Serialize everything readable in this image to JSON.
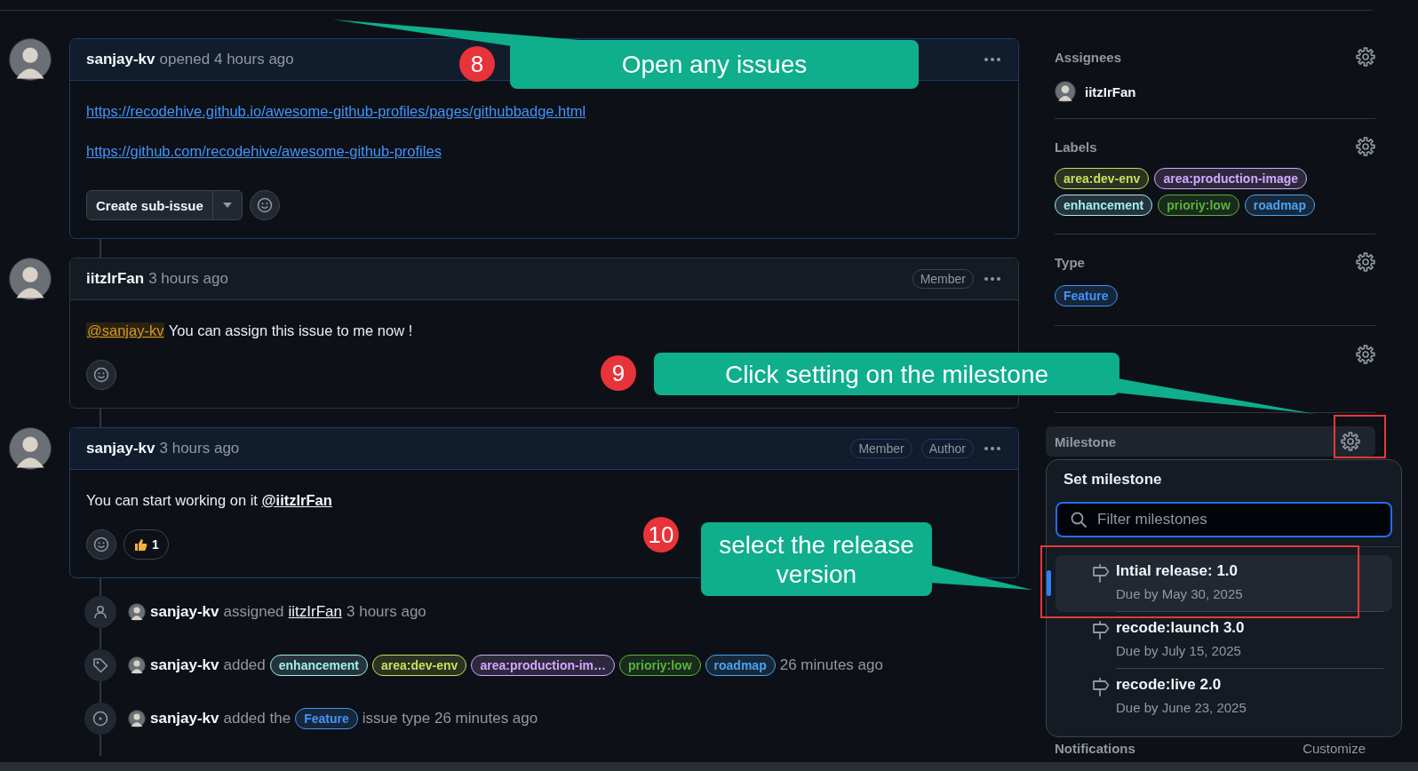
{
  "comments": [
    {
      "author": "sanjay-kv",
      "meta": "opened 4 hours ago",
      "highlighted": true,
      "body": [
        [
          {
            "kind": "link",
            "text": "https://recodehive.github.io/awesome-github-profiles/pages/githubbadge.html"
          }
        ],
        [
          {
            "kind": "link",
            "text": "https://github.com/recodehive/awesome-github-profiles"
          }
        ]
      ],
      "sub_issue_button": "Create sub-issue"
    },
    {
      "author": "iitzIrFan",
      "meta": "3 hours ago",
      "highlighted": false,
      "badges": [
        "Member"
      ],
      "body": [
        [
          {
            "kind": "mention-self",
            "text": "@sanjay-kv"
          },
          {
            "kind": "text",
            "text": "You can assign this issue to me now !"
          }
        ]
      ]
    },
    {
      "author": "sanjay-kv",
      "meta": "3 hours ago",
      "highlighted": true,
      "badges": [
        "Member",
        "Author"
      ],
      "body": [
        [
          {
            "kind": "text",
            "text": "You can start working on it"
          },
          {
            "kind": "mention",
            "text": "@iitzIrFan"
          }
        ]
      ],
      "reactions": [
        {
          "kind": "thumbs-up",
          "count": "1"
        }
      ]
    }
  ],
  "events": [
    {
      "kind": "assigned",
      "actor": "sanjay-kv",
      "action": "assigned",
      "link": "iitzIrFan",
      "after": "3 hours ago"
    },
    {
      "kind": "labeled",
      "actor": "sanjay-kv",
      "action": "added",
      "labels": [
        {
          "name": "enhancement",
          "color": "#a2eeef"
        },
        {
          "name": "area:dev-env",
          "color": "#c6e05a"
        },
        {
          "name": "area:production-im…",
          "color": "#d2a8ff"
        },
        {
          "name": "prioriy:low",
          "color": "#58b43a"
        },
        {
          "name": "roadmap",
          "color": "#4aa3f0"
        }
      ],
      "after": "26 minutes ago"
    },
    {
      "kind": "typed",
      "actor": "sanjay-kv",
      "action": "added the",
      "labels": [
        {
          "name": "Feature",
          "color": "#4493f8"
        }
      ],
      "after": "issue type 26 minutes ago"
    }
  ],
  "sidebar": {
    "sections": [
      {
        "kind": "assignees",
        "title": "Assignees",
        "users": [
          "iitzIrFan"
        ]
      },
      {
        "kind": "labels",
        "title": "Labels",
        "labels": [
          {
            "name": "area:dev-env",
            "color": "#c6e05a"
          },
          {
            "name": "area:production-image",
            "color": "#d2a8ff"
          },
          {
            "name": "enhancement",
            "color": "#a2eeef"
          },
          {
            "name": "prioriy:low",
            "color": "#58b43a"
          },
          {
            "name": "roadmap",
            "color": "#4aa3f0"
          }
        ]
      },
      {
        "kind": "type",
        "title": "Type",
        "labels": [
          {
            "name": "Feature",
            "color": "#4493f8"
          }
        ]
      },
      {
        "kind": "projects"
      },
      {
        "kind": "milestone",
        "title": "Milestone",
        "active": true,
        "highlighted": true
      }
    ],
    "milestone_menu": {
      "title": "Set milestone",
      "search": {
        "placeholder": "Filter milestones"
      },
      "items": [
        {
          "title": "Intial release: 1.0",
          "due": "Due by May 30, 2025",
          "selected": true,
          "highlighted": true
        },
        {
          "title": "recode:launch 3.0",
          "due": "Due by July 15, 2025",
          "selected": false,
          "highlighted": false
        },
        {
          "title": "recode:live 2.0",
          "due": "Due by June 23, 2025",
          "selected": false,
          "highlighted": false
        }
      ]
    },
    "notifications": {
      "title": "Notifications",
      "action": "Customize"
    }
  },
  "annotations": [
    {
      "number": "8",
      "text": "Open any issues"
    },
    {
      "number": "9",
      "text": "Click setting on the milestone"
    },
    {
      "number": "10",
      "text": "select the release version"
    }
  ]
}
